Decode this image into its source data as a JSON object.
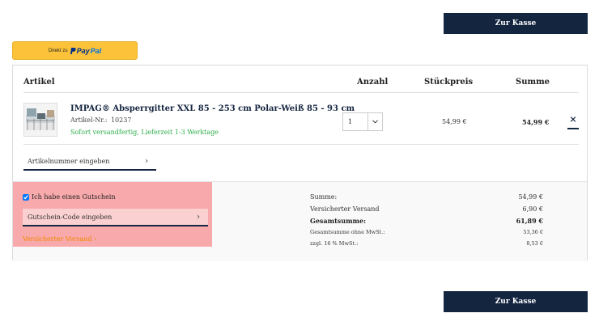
{
  "buttons": {
    "checkout": "Zur Kasse"
  },
  "paypal": {
    "prefix": "Direkt zu",
    "brand_pay": "Pay",
    "brand_pal": "Pal"
  },
  "table_headers": {
    "artikel": "Artikel",
    "anzahl": "Anzahl",
    "stueckpreis": "Stückpreis",
    "summe": "Summe"
  },
  "item": {
    "name": "IMPAG® Absperrgitter XXL 85 - 253 cm Polar-Weiß 85 - 93 cm",
    "artnr_label": "Artikel-Nr.:",
    "artnr": "10237",
    "availability": "Sofort versandfertig, Lieferzeit 1-3 Werktage",
    "quantity": "1",
    "unit_price": "54,99 €",
    "total": "54,99 €",
    "remove": "×"
  },
  "artikel_input": {
    "placeholder": "Artikelnummer eingeben",
    "arrow": "›"
  },
  "voucher": {
    "checkbox_label": "Ich habe einen Gutschein",
    "checked": true,
    "code_placeholder": "Gutschein-Code eingeben",
    "arrow": "›",
    "insured_link": "Versicherter Versand ›"
  },
  "totals": [
    {
      "label": "Summe:",
      "value": "54,99 €",
      "style": "normal"
    },
    {
      "label": "Versicherter Versand",
      "value": "6,90 €",
      "style": "normal"
    },
    {
      "label": "Gesamtsumme:",
      "value": "61,89 €",
      "style": "bold"
    },
    {
      "label": "Gesamtsumme ohne MwSt.:",
      "value": "53,36 €",
      "style": "small"
    },
    {
      "label": "zzgl. 16 % MwSt.:",
      "value": "8,53 €",
      "style": "small"
    }
  ],
  "colors": {
    "navy": "#142540",
    "paypal_yellow": "#fcc33a",
    "green": "#2fae4b",
    "orange": "#f08a00",
    "highlight": "#f8a9ab"
  }
}
